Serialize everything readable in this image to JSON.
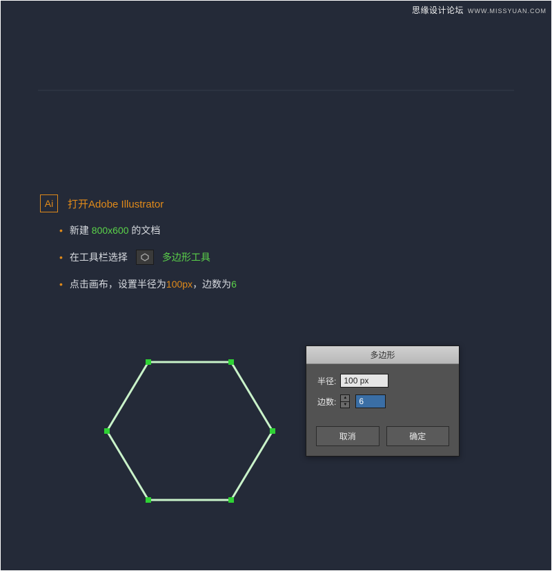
{
  "watermark": {
    "cn": "思缘设计论坛",
    "url": "WWW.MISSYUAN.COM"
  },
  "ai_icon_label": "Ai",
  "title": "打开Adobe Illustrator",
  "bullets": {
    "b1_pre": "新建",
    "b1_green": "800x600",
    "b1_post": " 的文档",
    "b2_pre": "在工具栏选择",
    "b2_green": "多边形工具",
    "b3_pre": "点击画布，设置半径为",
    "b3_val1": "100px",
    "b3_mid": "，边数为",
    "b3_val2": "6"
  },
  "dialog": {
    "title": "多边形",
    "radius_label": "半径:",
    "radius_value": "100 px",
    "sides_label": "边数:",
    "sides_value": "6",
    "cancel": "取消",
    "ok": "确定"
  },
  "hexagon": {
    "stroke": "#c0f0c0",
    "anchor": "#2fd235"
  }
}
